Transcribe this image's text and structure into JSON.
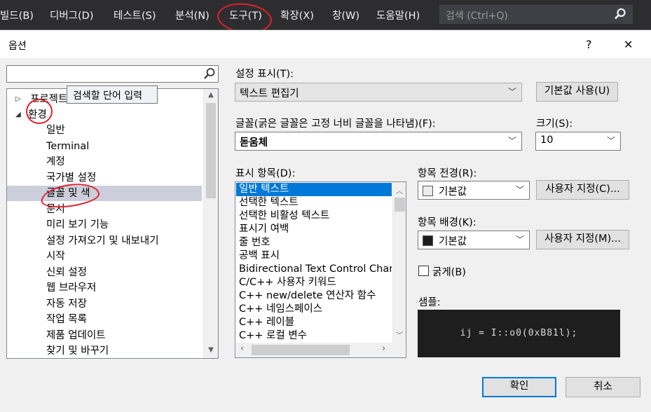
{
  "menubar": {
    "items": [
      "빌드(B)",
      "디버그(D)",
      "테스트(S)",
      "분석(N)",
      "도구(T)",
      "확장(X)",
      "창(W)",
      "도움말(H)"
    ],
    "search_placeholder": "검색 (Ctrl+Q)"
  },
  "dialog": {
    "title": "옵션",
    "help": "?",
    "close": "✕"
  },
  "tree": {
    "tooltip": "검색할 단어 입력",
    "items": [
      "프로젝트",
      "환경",
      "일반",
      "Terminal",
      "계정",
      "국가별 설정",
      "글꼴 및 색",
      "문서",
      "미리 보기 기능",
      "설정 가져오기 및 내보내기",
      "시작",
      "신뢰 설정",
      "웹 브라우저",
      "자동 저장",
      "작업 목록",
      "제품 업데이트",
      "찾기 및 바꾸기"
    ],
    "selected": "글꼴 및 색"
  },
  "settings": {
    "show_settings_label": "설정 표시(T):",
    "show_settings_value": "텍스트 편집기",
    "default_button": "기본값 사용(U)",
    "font_label": "글꼴(굵은 글꼴은 고정 너비 글꼴을 나타냄)(F):",
    "font_value": "돋움체",
    "size_label": "크기(S):",
    "size_value": "10",
    "display_items_label": "표시 항목(D):",
    "display_items": [
      "일반 텍스트",
      "선택한 텍스트",
      "선택한 비활성 텍스트",
      "표시기 여백",
      "줄 번호",
      "공백 표시",
      "Bidirectional Text Control Character",
      "C/C++ 사용자 키워드",
      "C++ new/delete 연산자 함수",
      "C++ 네임스페이스",
      "C++ 레이블",
      "C++ 로컬 변수"
    ],
    "selected_item": "일반 텍스트",
    "fg_label": "항목 전경(R):",
    "fg_value": "기본값",
    "fg_custom": "사용자 지정(C)...",
    "bg_label": "항목 배경(K):",
    "bg_value": "기본값",
    "bg_custom": "사용자 지정(M)...",
    "bold_label": "굵게(B)",
    "sample_label": "샘플:",
    "sample_text": "ij = I::o0(0xB81l);"
  },
  "footer": {
    "ok": "확인",
    "cancel": "취소"
  },
  "colors": {
    "menubar_bg": "#2d2d30",
    "accent": "#0078d7",
    "annotation_red": "#e0202a"
  }
}
